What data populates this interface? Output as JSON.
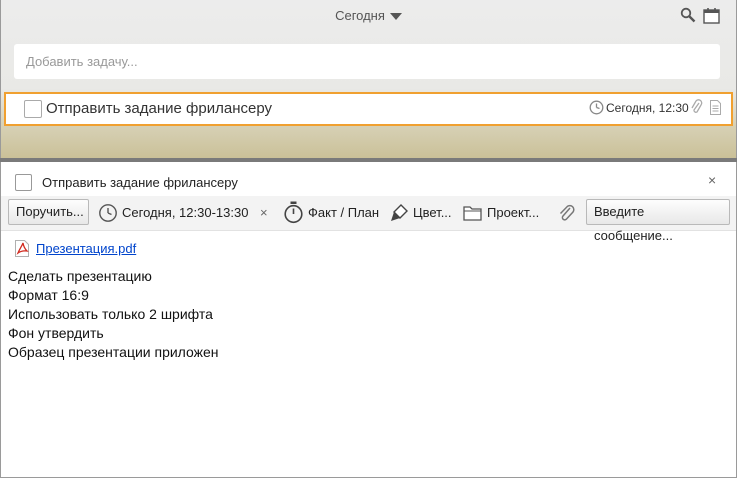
{
  "header": {
    "date_filter": "Сегодня"
  },
  "add_task": {
    "placeholder": "Добавить задачу..."
  },
  "task": {
    "title": "Отправить задание фрилансеру",
    "time": "Сегодня, 12:30"
  },
  "detail": {
    "title": "Отправить задание фрилансеру",
    "close": "×",
    "toolbar": {
      "assign": "Поручить...",
      "datetime": "Сегодня, 12:30-13:30",
      "clear": "×",
      "fact_plan": "Факт / План",
      "color": "Цвет...",
      "project": "Проект...",
      "message": "Введите сообщение..."
    },
    "attachment": "Презентация.pdf",
    "notes": [
      "Сделать презентацию",
      "Формат 16:9",
      "Использовать только 2 шрифта",
      "Фон утвердить",
      "Образец презентации приложен"
    ]
  },
  "colors": {
    "accent": "#f0a030",
    "link": "#0044cc"
  }
}
